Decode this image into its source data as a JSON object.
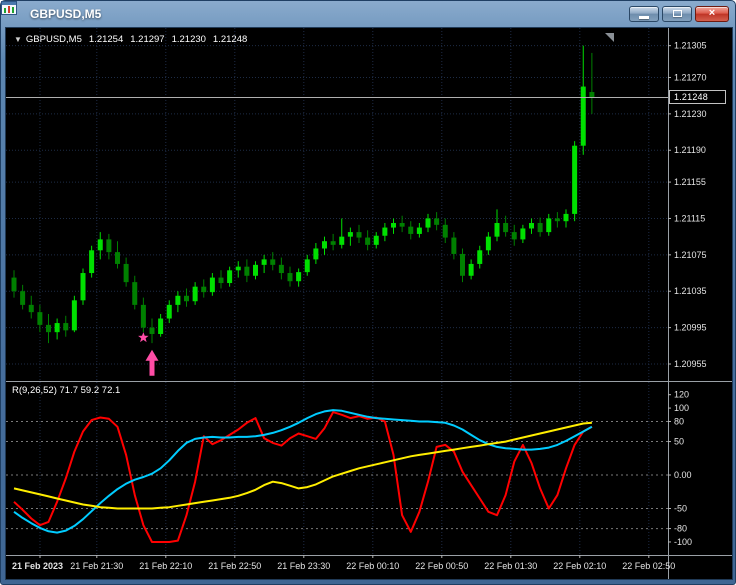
{
  "window": {
    "title": "GBPUSD,M5",
    "close_glyph": "×"
  },
  "chart": {
    "dropdown_glyph": "▼",
    "symbol": "GBPUSD,M5",
    "ohlc": {
      "open": "1.21254",
      "high": "1.21297",
      "low": "1.21230",
      "close": "1.21248"
    },
    "current_price": "1.21248",
    "price_axis": [
      "1.21305",
      "1.21270",
      "1.21230",
      "1.21190",
      "1.21155",
      "1.21115",
      "1.21075",
      "1.21035",
      "1.20995",
      "1.20955"
    ],
    "time_axis": [
      "21 Feb 2023",
      "21 Feb 21:30",
      "21 Feb 22:10",
      "21 Feb 22:50",
      "21 Feb 23:30",
      "22 Feb 00:10",
      "22 Feb 00:50",
      "22 Feb 01:30",
      "22 Feb 02:10",
      "22 Feb 02:50"
    ]
  },
  "indicator": {
    "label": "R(9,26,52) 71.7 59.2 72.1",
    "axis": [
      {
        "label": "120",
        "value": 120
      },
      {
        "label": "100",
        "value": 100
      },
      {
        "label": "80",
        "value": 80
      },
      {
        "label": "50",
        "value": 50
      },
      {
        "label": "0.00",
        "value": 0
      },
      {
        "label": "-50",
        "value": -50
      },
      {
        "label": "-80",
        "value": -80
      },
      {
        "label": "-100",
        "value": -100
      }
    ],
    "level_lines": [
      80,
      50,
      0,
      -50,
      -80
    ]
  },
  "colors": {
    "background": "#000000",
    "grid": "#1e2c46",
    "candle_up": "#00e000",
    "candle_down": "#008000",
    "series_red": "#ff0000",
    "series_cyan": "#00ccff",
    "series_yellow": "#ffee00",
    "axis_text": "#e4e4e4",
    "level_line": "#7a7a7a",
    "price_line": "#b0b0b0",
    "marker_pink": "#ff4da6"
  },
  "chart_data": {
    "type": "candlestick",
    "title": "GBPUSD,M5",
    "price_range": [
      1.20944,
      1.2132
    ],
    "indicator_range": [
      -112,
      130
    ],
    "time_label_first_index": 9.6,
    "time_label_step": 8,
    "candles": [
      [
        1.2105,
        1.21058,
        1.21028,
        1.21035
      ],
      [
        1.21035,
        1.21042,
        1.21015,
        1.2102
      ],
      [
        1.2102,
        1.2103,
        1.21005,
        1.21012
      ],
      [
        1.21012,
        1.2102,
        1.2099,
        1.20998
      ],
      [
        1.20998,
        1.2101,
        1.20978,
        1.2099
      ],
      [
        1.2099,
        1.21005,
        1.20982,
        1.21
      ],
      [
        1.21,
        1.21008,
        1.20985,
        1.20992
      ],
      [
        1.20992,
        1.2103,
        1.2099,
        1.21025
      ],
      [
        1.21025,
        1.2106,
        1.2102,
        1.21055
      ],
      [
        1.21055,
        1.21085,
        1.2105,
        1.2108
      ],
      [
        1.2108,
        1.211,
        1.2107,
        1.21092
      ],
      [
        1.21092,
        1.21098,
        1.2107,
        1.21078
      ],
      [
        1.21078,
        1.2109,
        1.2106,
        1.21065
      ],
      [
        1.21065,
        1.21072,
        1.2104,
        1.21045
      ],
      [
        1.21045,
        1.21052,
        1.21015,
        1.2102
      ],
      [
        1.2102,
        1.21028,
        1.2099,
        1.20995
      ],
      [
        1.20995,
        1.21005,
        1.20978,
        1.20988
      ],
      [
        1.20988,
        1.2101,
        1.20985,
        1.21005
      ],
      [
        1.21005,
        1.21025,
        1.21,
        1.2102
      ],
      [
        1.2102,
        1.21035,
        1.21012,
        1.2103
      ],
      [
        1.2103,
        1.21038,
        1.21018,
        1.21024
      ],
      [
        1.21024,
        1.21045,
        1.2102,
        1.2104
      ],
      [
        1.2104,
        1.21048,
        1.21028,
        1.21034
      ],
      [
        1.21034,
        1.21055,
        1.2103,
        1.2105
      ],
      [
        1.2105,
        1.21058,
        1.21038,
        1.21044
      ],
      [
        1.21044,
        1.21062,
        1.2104,
        1.21058
      ],
      [
        1.21058,
        1.21068,
        1.2105,
        1.21062
      ],
      [
        1.21062,
        1.2107,
        1.21045,
        1.21052
      ],
      [
        1.21052,
        1.21068,
        1.21048,
        1.21064
      ],
      [
        1.21064,
        1.21075,
        1.21055,
        1.2107
      ],
      [
        1.2107,
        1.21078,
        1.21058,
        1.21064
      ],
      [
        1.21064,
        1.21072,
        1.21048,
        1.21055
      ],
      [
        1.21055,
        1.21062,
        1.2104,
        1.21046
      ],
      [
        1.21046,
        1.2106,
        1.2104,
        1.21056
      ],
      [
        1.21056,
        1.21075,
        1.21052,
        1.2107
      ],
      [
        1.2107,
        1.21088,
        1.21065,
        1.21082
      ],
      [
        1.21082,
        1.21095,
        1.21075,
        1.2109
      ],
      [
        1.2109,
        1.21098,
        1.2108,
        1.21086
      ],
      [
        1.21086,
        1.21115,
        1.21082,
        1.21095
      ],
      [
        1.21095,
        1.21105,
        1.21085,
        1.211
      ],
      [
        1.211,
        1.21108,
        1.21088,
        1.21094
      ],
      [
        1.21094,
        1.21102,
        1.2108,
        1.21086
      ],
      [
        1.21086,
        1.211,
        1.21082,
        1.21096
      ],
      [
        1.21096,
        1.2111,
        1.2109,
        1.21105
      ],
      [
        1.21105,
        1.21115,
        1.21098,
        1.2111
      ],
      [
        1.2111,
        1.21118,
        1.211,
        1.21106
      ],
      [
        1.21106,
        1.21112,
        1.21092,
        1.21098
      ],
      [
        1.21098,
        1.2111,
        1.21094,
        1.21105
      ],
      [
        1.21105,
        1.2112,
        1.211,
        1.21115
      ],
      [
        1.21115,
        1.21122,
        1.21102,
        1.21108
      ],
      [
        1.21108,
        1.21115,
        1.21088,
        1.21094
      ],
      [
        1.21094,
        1.211,
        1.2107,
        1.21076
      ],
      [
        1.21076,
        1.21082,
        1.21045,
        1.21052
      ],
      [
        1.21052,
        1.2107,
        1.21048,
        1.21065
      ],
      [
        1.21065,
        1.21085,
        1.2106,
        1.2108
      ],
      [
        1.2108,
        1.211,
        1.21075,
        1.21095
      ],
      [
        1.21095,
        1.21125,
        1.2109,
        1.2111
      ],
      [
        1.2111,
        1.21118,
        1.21095,
        1.211
      ],
      [
        1.211,
        1.21108,
        1.21085,
        1.21092
      ],
      [
        1.21092,
        1.21108,
        1.21088,
        1.21104
      ],
      [
        1.21104,
        1.21115,
        1.21098,
        1.2111
      ],
      [
        1.2111,
        1.21116,
        1.21095,
        1.211
      ],
      [
        1.211,
        1.2112,
        1.21096,
        1.21115
      ],
      [
        1.21115,
        1.21122,
        1.21105,
        1.21112
      ],
      [
        1.21112,
        1.21125,
        1.21105,
        1.2112
      ],
      [
        1.2112,
        1.212,
        1.21112,
        1.21195
      ],
      [
        1.21195,
        1.21305,
        1.21185,
        1.2126
      ],
      [
        1.21254,
        1.21297,
        1.2123,
        1.21248
      ]
    ],
    "series": [
      {
        "name": "red",
        "color_key": "series_red",
        "values": [
          -40,
          -52,
          -65,
          -75,
          -70,
          -40,
          -5,
          35,
          65,
          82,
          86,
          84,
          72,
          30,
          -30,
          -75,
          -100,
          -100,
          -100,
          -98,
          -60,
          -10,
          58,
          46,
          52,
          60,
          68,
          78,
          85,
          55,
          48,
          44,
          55,
          62,
          58,
          54,
          70,
          94,
          90,
          85,
          88,
          84,
          86,
          80,
          30,
          -60,
          -85,
          -55,
          -10,
          42,
          45,
          35,
          5,
          -15,
          -35,
          -55,
          -60,
          -30,
          20,
          45,
          18,
          -20,
          -50,
          -30,
          10,
          45,
          65,
          72
        ]
      },
      {
        "name": "cyan",
        "color_key": "series_cyan",
        "values": [
          -55,
          -64,
          -72,
          -79,
          -84,
          -86,
          -83,
          -76,
          -66,
          -54,
          -42,
          -31,
          -21,
          -13,
          -7,
          -3,
          2,
          10,
          22,
          36,
          48,
          54,
          56,
          57,
          56,
          56,
          57,
          57,
          58,
          60,
          63,
          67,
          72,
          78,
          85,
          91,
          95,
          97,
          96,
          93,
          90,
          87,
          85,
          84,
          83,
          82,
          81,
          80,
          80,
          79,
          78,
          74,
          68,
          60,
          52,
          46,
          42,
          40,
          39,
          38,
          38,
          39,
          41,
          45,
          51,
          58,
          65,
          72
        ]
      },
      {
        "name": "yellow",
        "color_key": "series_yellow",
        "values": [
          -20,
          -23,
          -26,
          -29,
          -32,
          -35,
          -38,
          -41,
          -44,
          -46,
          -48,
          -49,
          -50,
          -50,
          -50,
          -50,
          -50,
          -49,
          -48,
          -46,
          -44,
          -42,
          -40,
          -38,
          -36,
          -34,
          -31,
          -27,
          -22,
          -15,
          -10,
          -12,
          -16,
          -20,
          -18,
          -14,
          -8,
          -2,
          2,
          6,
          10,
          13,
          16,
          19,
          22,
          25,
          28,
          30,
          32,
          34,
          36,
          38,
          40,
          42,
          44,
          46,
          48,
          50,
          53,
          56,
          59,
          62,
          65,
          68,
          71,
          74,
          77,
          78
        ]
      }
    ],
    "markers": [
      {
        "type": "star",
        "index": 15,
        "price": 1.20984
      },
      {
        "type": "arrow-up",
        "index": 16,
        "price": 1.20975
      }
    ]
  }
}
